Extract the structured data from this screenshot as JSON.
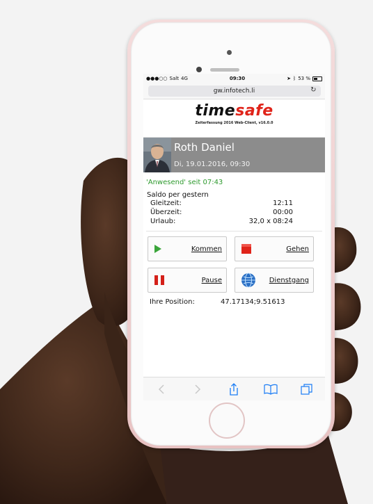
{
  "status_bar": {
    "carrier": "Salt",
    "network": "4G",
    "time": "09:30",
    "battery": "53 %"
  },
  "browser": {
    "url": "gw.infotech.li"
  },
  "logo": {
    "part1": "time",
    "part2": "safe",
    "subtitle": "Zeiterfassung 2016 Web-Client, v16.0.0"
  },
  "user": {
    "name": "Roth Daniel",
    "datetime": "Di, 19.01.2016, 09:30"
  },
  "status": "'Anwesend' seit 07:43",
  "balance": {
    "heading": "Saldo per gestern",
    "rows": [
      {
        "label": "Gleitzeit:",
        "value": "12:11"
      },
      {
        "label": "Überzeit:",
        "value": "00:00"
      },
      {
        "label": "Urlaub:",
        "value": "32,0 x 08:24"
      }
    ]
  },
  "actions": {
    "kommen": "Kommen",
    "gehen": "Gehen",
    "pause": "Pause",
    "dienstgang": "Dienstgang"
  },
  "position": {
    "label": "Ihre Position:",
    "value": "47.17134;9.51613"
  },
  "colors": {
    "accent_red": "#e0241a",
    "status_green": "#2e9a2e",
    "banner_gray": "#8c8c8c"
  }
}
